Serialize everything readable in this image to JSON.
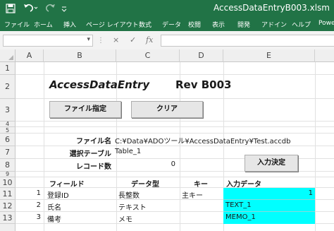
{
  "window": {
    "title": "AccessDataEntryB003.xlsm",
    "accent": "#217346"
  },
  "quick_access": {
    "save_icon": "save-icon",
    "undo_icon": "undo-icon",
    "redo_icon": "redo-icon"
  },
  "ribbon": {
    "tabs": [
      "ファイル",
      "ホーム",
      "挿入",
      "ページ レイアウト",
      "数式",
      "データ",
      "校閲",
      "表示",
      "開発",
      "アドイン",
      "ヘルプ",
      "Powe"
    ]
  },
  "formula_bar": {
    "cell_ref": "",
    "cancel_icon": "×",
    "enter_icon": "✓",
    "fx": "fx",
    "content": ""
  },
  "sheet": {
    "columns": [
      "A",
      "B",
      "C",
      "D",
      "E"
    ],
    "rows": [
      "1",
      "2",
      "3",
      "4",
      "5",
      "6",
      "7",
      "8",
      "9",
      "10",
      "11",
      "12",
      "13"
    ],
    "title": "AccessDataEntry",
    "revision": "Rev B003",
    "buttons": {
      "file_select": "ファイル指定",
      "clear": "クリア",
      "commit": "入力決定"
    },
    "labels": {
      "file_name": "ファイル名",
      "file_path": "C:¥Data¥ADOツール¥AccessDataEntry¥Test.accdb",
      "table_select": "選択テーブル",
      "table_value": "Table_1",
      "record_count": "レコード数",
      "record_count_value": "0"
    },
    "table": {
      "headers": [
        "フィールド",
        "データ型",
        "キー",
        "入力データ"
      ],
      "rows": [
        {
          "num": "1",
          "field": "登録ID",
          "type": "長整数",
          "key": "主キー",
          "input": "1"
        },
        {
          "num": "2",
          "field": "氏名",
          "type": "テキスト",
          "key": "",
          "input": "TEXT_1"
        },
        {
          "num": "3",
          "field": "備考",
          "type": "メモ",
          "key": "",
          "input": "MEMO_1"
        }
      ],
      "input_highlight": "#00ffff"
    }
  }
}
